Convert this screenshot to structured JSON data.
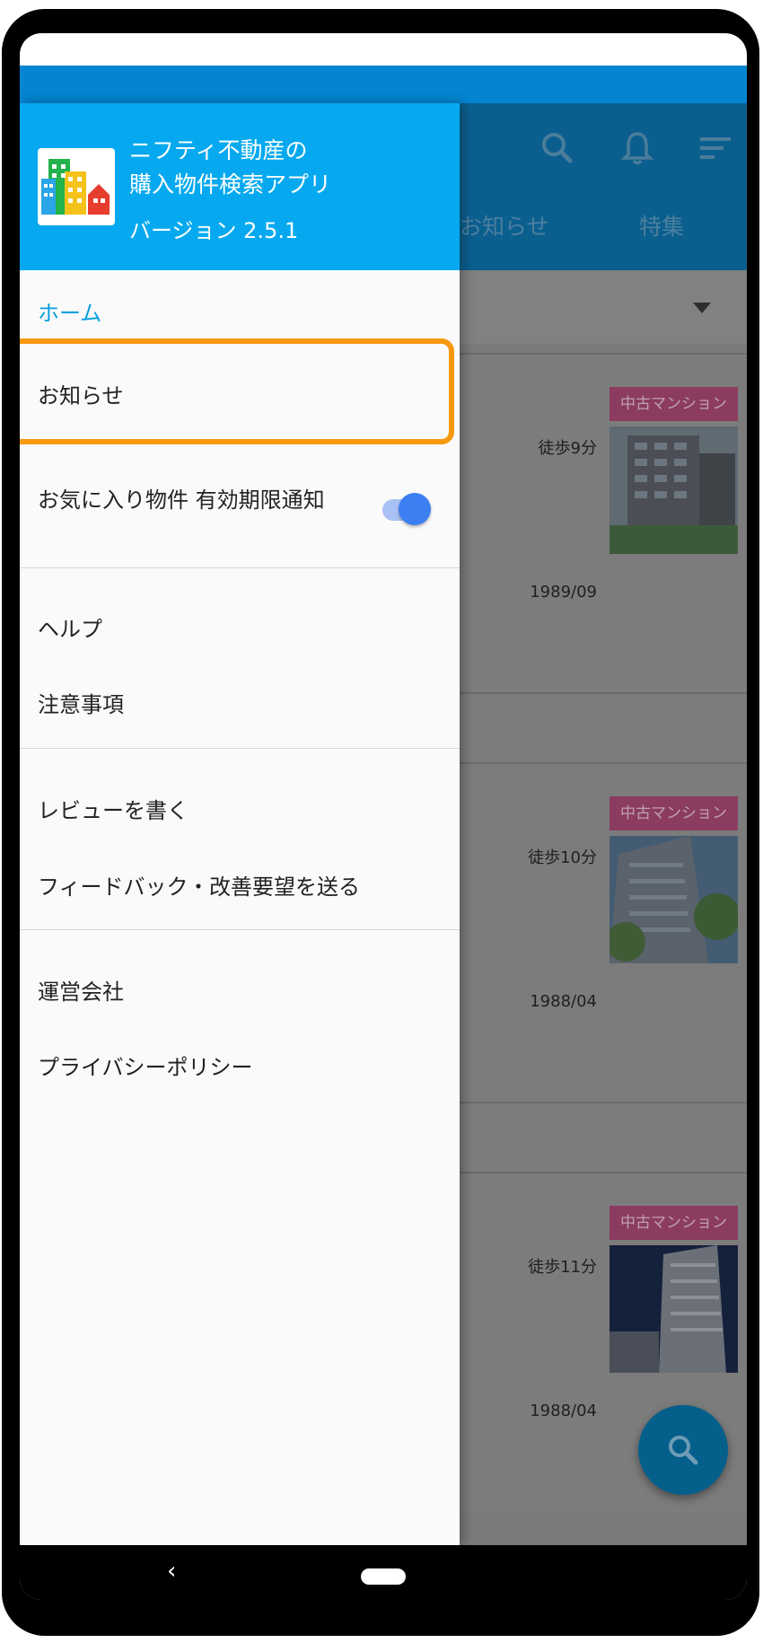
{
  "app_bar": {
    "tabs": [
      "お知らせ",
      "特集"
    ]
  },
  "drawer": {
    "header": {
      "title_line1": "ニフティ不動産の",
      "title_line2": "購入物件検索アプリ",
      "version": "バージョン 2.5.1"
    },
    "items": {
      "home": "ホーム",
      "news": "お知らせ",
      "favorite_notice": "お気に入り物件 有効期限通知",
      "help": "ヘルプ",
      "notes": "注意事項",
      "review": "レビューを書く",
      "feedback": "フィードバック・改善要望を送る",
      "company": "運営会社",
      "privacy": "プライバシーポリシー"
    },
    "favorite_notice_toggle": "on",
    "highlight_color": "#f7990f"
  },
  "listings": [
    {
      "badge": "中古マンション",
      "walk": "徒歩9分",
      "built": "1989/09"
    },
    {
      "badge": "中古マンション",
      "walk": "徒歩10分",
      "built": "1988/04"
    },
    {
      "badge": "中古マンション",
      "walk": "徒歩11分",
      "built": "1988/04"
    }
  ],
  "icons": [
    "search-icon",
    "bell-icon",
    "sort-icon",
    "dropdown-arrow-icon",
    "fab-search-icon",
    "back-icon",
    "home-pill-icon"
  ],
  "colors": {
    "drawer_header": "#06a9ef",
    "accent": "#06a0e0",
    "toggle_on": "#3b7ff2",
    "badge": "#e64d8e"
  }
}
